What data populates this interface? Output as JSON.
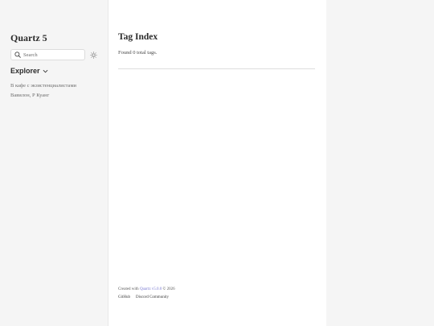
{
  "site": {
    "title": "Quartz 5"
  },
  "search": {
    "placeholder": "Search"
  },
  "explorer": {
    "label": "Explorer",
    "items": [
      {
        "label": "В кафе с экзистенциалистами"
      },
      {
        "label": "Вавилон, Р Куанг"
      }
    ]
  },
  "main": {
    "title": "Tag Index",
    "tag_count_text": "Found 0 total tags."
  },
  "footer": {
    "created_prefix": "Created with",
    "quartz_link": "Quartz v5.0.0",
    "created_suffix": "© 2026",
    "links": [
      {
        "label": "GitHub"
      },
      {
        "label": "Discord Community"
      }
    ]
  },
  "colors": {
    "accent_link": "#7b7bd1",
    "background": "#f5f5f5",
    "content_bg": "#ffffff"
  }
}
